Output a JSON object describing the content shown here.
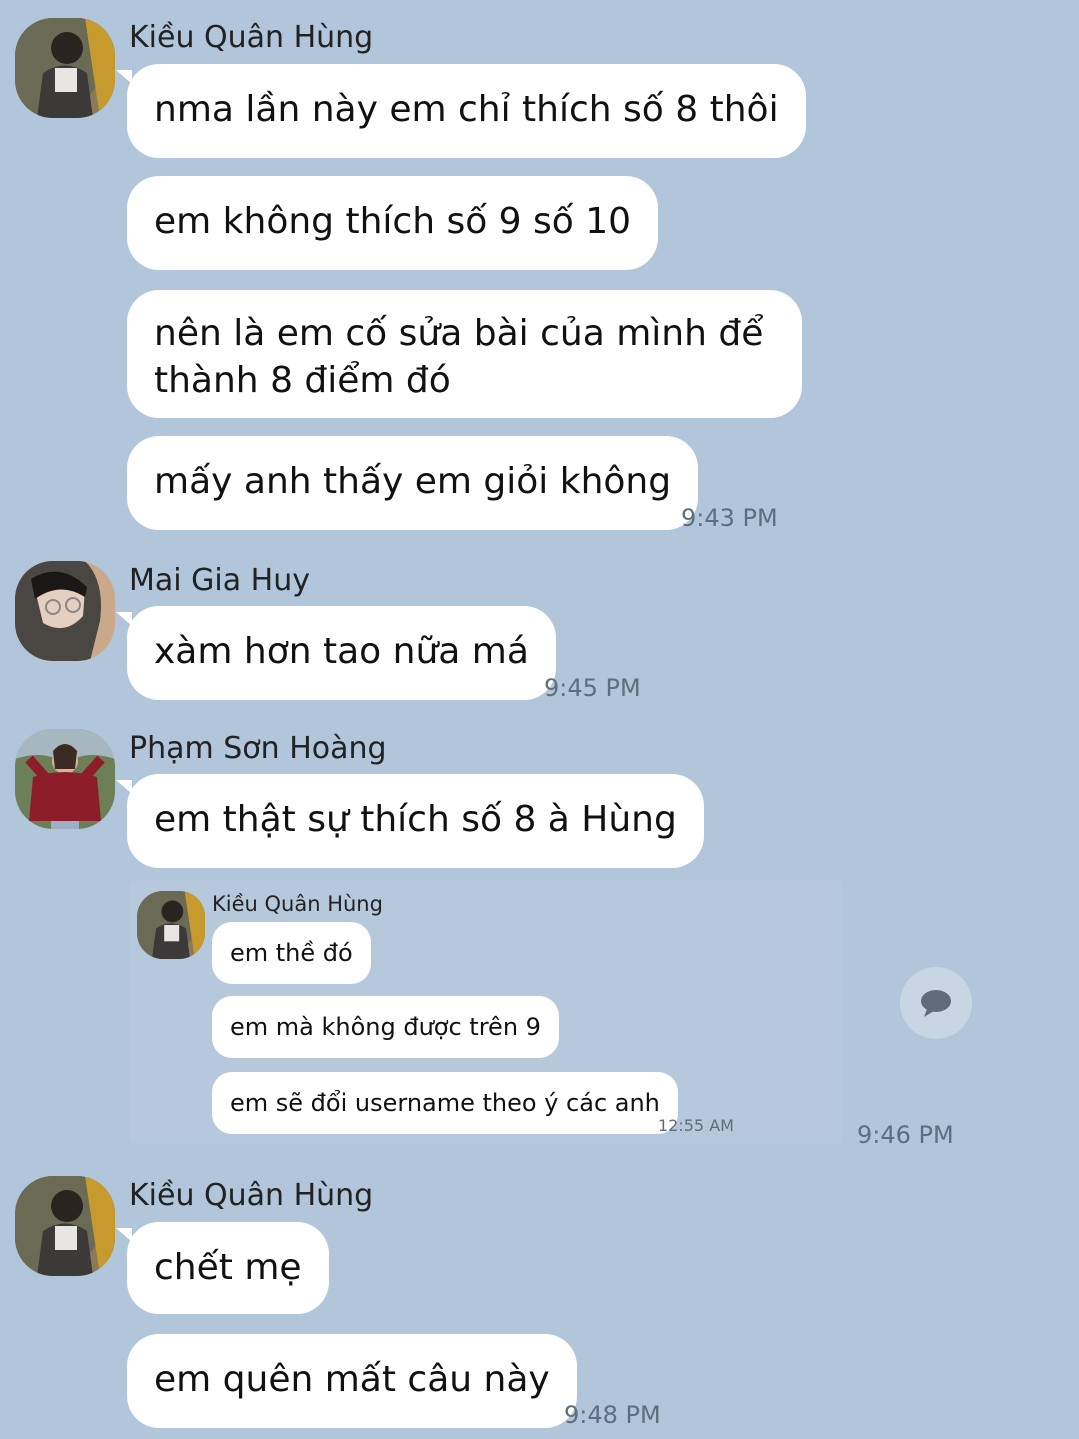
{
  "messages": [
    {
      "sender": "Kiều Quân Hùng",
      "avatar_icon": "user-avatar-hung",
      "bubbles": [
        "nma lần này em chỉ thích số 8 thôi",
        "em không thích số 9 số 10",
        "nên là em cố sửa bài của mình để thành 8 điểm đó",
        "mấy anh thấy em giỏi không"
      ],
      "time": "9:43 PM"
    },
    {
      "sender": "Mai Gia Huy",
      "avatar_icon": "user-avatar-huy",
      "bubbles": [
        "xàm hơn tao nữa má"
      ],
      "time": "9:45 PM"
    },
    {
      "sender": "Phạm Sơn Hoàng",
      "avatar_icon": "user-avatar-hoang",
      "bubbles": [
        "em thật sự thích số 8 à Hùng"
      ],
      "time": "9:46 PM",
      "quoted": {
        "sender": "Kiều Quân Hùng",
        "bubbles": [
          "em thề đó",
          "em mà không được trên 9",
          "em sẽ đổi username theo ý các anh"
        ],
        "time": "12:55 AM"
      }
    },
    {
      "sender": "Kiều Quân Hùng",
      "avatar_icon": "user-avatar-hung",
      "bubbles": [
        "chết mẹ",
        "em quên mất câu này"
      ],
      "time": "9:48 PM"
    }
  ],
  "reply_icon": "chat-bubble-icon",
  "colors": {
    "background": "#b1c6da",
    "bubble": "#ffffff",
    "timestamp": "#5d6e7c"
  }
}
